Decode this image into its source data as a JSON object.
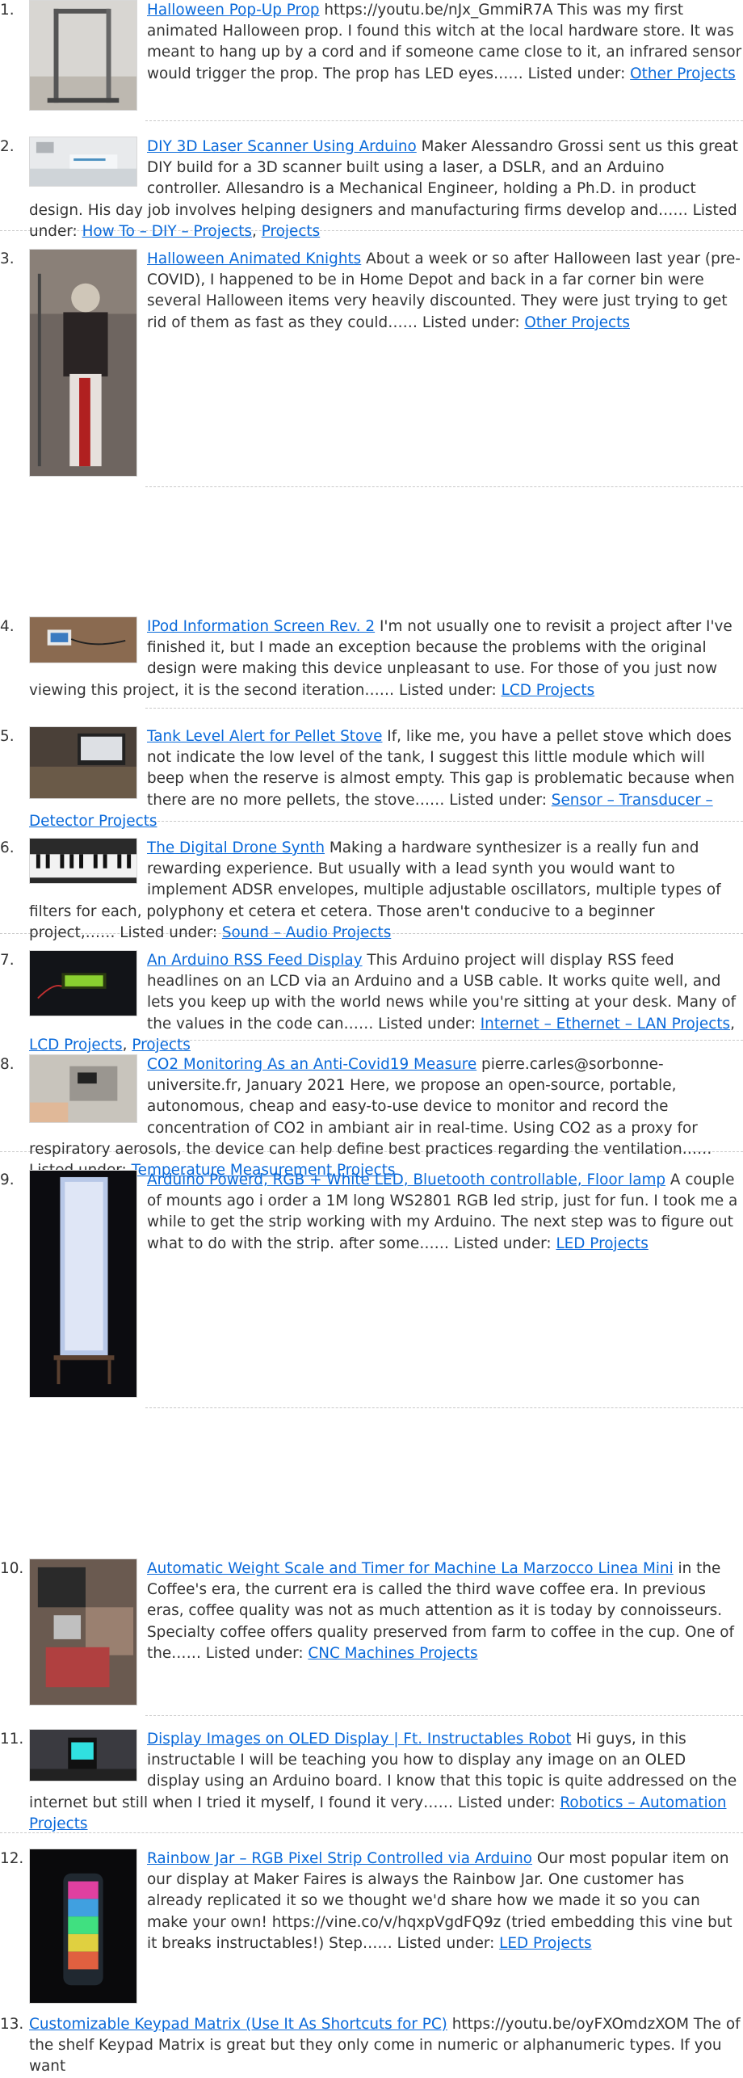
{
  "items": [
    {
      "num": "1.",
      "title": "Halloween Pop-Up Prop",
      "text": " https://youtu.be/nJx_GmmiR7A This was my first animated Halloween prop. I found this witch at the local hardware store. It was meant to hang up by a cord and if someone came close to it, an infrared sensor would trigger the prop. The prop has LED eyes…… Listed under: ",
      "categories": [
        "Other Projects"
      ]
    },
    {
      "num": "2.",
      "title": "DIY 3D Laser Scanner Using Arduino",
      "text": " Maker Alessandro Grossi sent us this great DIY build for a 3D scanner built using a laser, a DSLR, and an Arduino controller. Allesandro is a Mechanical Engineer, holding a Ph.D. in product design. His day job involves helping designers and manufacturing firms develop and…… Listed under: ",
      "categories": [
        "How To – DIY – Projects",
        "Projects"
      ]
    },
    {
      "num": "3.",
      "title": "Halloween Animated Knights",
      "text": " About a week or so after Halloween last year (pre-COVID), I happened to be in Home Depot and back in a far corner bin were several Halloween items very heavily discounted. They were just trying to get rid of them as fast as they could…… Listed under: ",
      "categories": [
        "Other Projects"
      ]
    },
    {
      "num": "4.",
      "title": "IPod Information Screen Rev. 2",
      "text": " I'm not usually one to revisit a project after I've finished it, but I made an exception because the problems with the original design were making this device unpleasant to use. For those of you just now viewing this project, it is the second iteration…… Listed under: ",
      "categories": [
        "LCD Projects"
      ]
    },
    {
      "num": "5.",
      "title": "Tank Level Alert for Pellet Stove",
      "text": " If, like me, you have a pellet stove which does not indicate the low level of the tank, I suggest this little module which will beep when the reserve is almost empty. This gap is problematic because when there are no more pellets, the stove…… Listed under: ",
      "categories": [
        "Sensor – Transducer – Detector Projects"
      ]
    },
    {
      "num": "6.",
      "title": "The Digital Drone Synth",
      "text": " Making a hardware synthesizer is a really fun and rewarding experience. But usually with a lead synth you would want to implement ADSR envelopes, multiple adjustable oscillators, multiple types of filters for each, polyphony et cetera et cetera. Those aren't conducive to a beginner project,…… Listed under: ",
      "categories": [
        "Sound – Audio Projects"
      ]
    },
    {
      "num": "7.",
      "title": "An Arduino RSS Feed Display",
      "text": " This Arduino project will display RSS feed headlines on an LCD via an Arduino and a USB cable. It works quite well, and lets you keep up with the world news while you're sitting at your desk. Many of the values in the code can…… Listed under: ",
      "categories": [
        "Internet – Ethernet – LAN Projects",
        "LCD Projects",
        "Projects"
      ]
    },
    {
      "num": "8.",
      "title": "CO2 Monitoring As an Anti-Covid19 Measure",
      "text": " pierre.carles@sorbonne-universite.fr, January 2021 Here, we propose an open-source, portable, autonomous, cheap and easy-to-use device to monitor and record the concentration of CO2 in ambiant air in real-time. Using CO2 as a proxy for respiratory aerosols, the device can help define best practices regarding the ventilation…… Listed under: ",
      "categories": [
        "Temperature Measurement Projects"
      ]
    },
    {
      "num": "9.",
      "title": "Arduino Powerd, RGB + White LED, Bluetooth controllable, Floor lamp",
      "text": " A couple of mounts ago i order a 1M long WS2801 RGB led strip, just for fun. I took me a while to get the strip working with my Arduino. The next step was to figure out what to do with the strip. after some…… Listed under: ",
      "categories": [
        "LED Projects"
      ]
    },
    {
      "num": "10.",
      "title": "Automatic Weight Scale and Timer for Machine La Marzocco Linea Mini",
      "text": " in the Coffee's era, the current era is called the third wave coffee era. In previous eras, coffee quality was not as much attention as it is today by connoisseurs. Specialty coffee offers quality preserved from farm to coffee in the cup. One of the…… Listed under: ",
      "categories": [
        "CNC Machines Projects"
      ]
    },
    {
      "num": "11.",
      "title": "Display Images on OLED Display | Ft. Instructables Robot",
      "text": " Hi guys, in this instructable I will be teaching you how to display any image on an OLED display using an Arduino board. I know that this topic is quite addressed on the internet but still when I tried it myself, I found it very…… Listed under: ",
      "categories": [
        "Robotics – Automation Projects"
      ]
    },
    {
      "num": "12.",
      "title": "Rainbow Jar – RGB Pixel Strip Controlled via Arduino",
      "text": " Our most popular item on our display at Maker Faires is always the Rainbow Jar. One customer has already replicated it so we thought we'd share how we made it so you can make your own! https://vine.co/v/hqxpVgdFQ9z (tried embedding this vine but it breaks instructables!) Step…… Listed under: ",
      "categories": [
        "LED Projects"
      ]
    },
    {
      "num": "13.",
      "title": "Customizable Keypad Matrix (Use It As Shortcuts for PC)",
      "text": " https://youtu.be/oyFXOmdzXOM The of the shelf Keypad Matrix is great but they only come in numeric or alphanumeric types. If you want",
      "categories": []
    }
  ]
}
